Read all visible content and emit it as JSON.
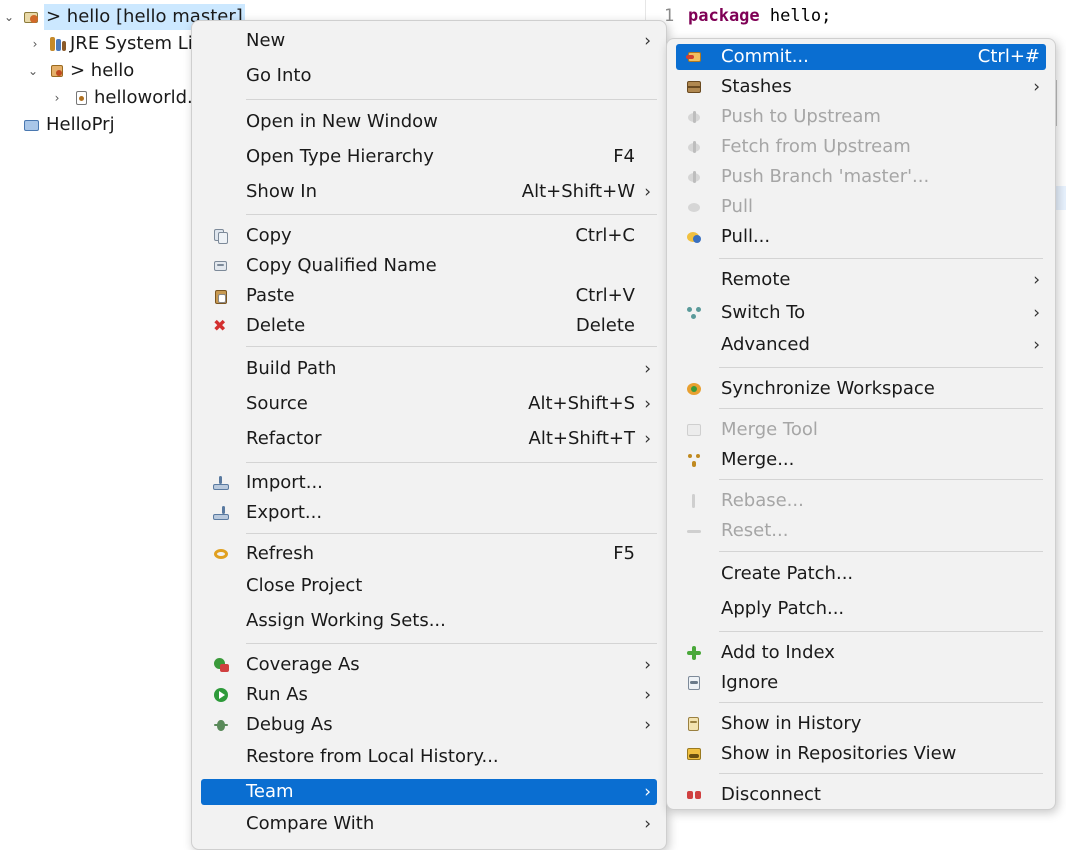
{
  "tree": {
    "project": "> hello [hello master]",
    "jre": "JRE System Lib",
    "package": "> hello",
    "file": "helloworld.",
    "other_project": "HelloPrj"
  },
  "editor": {
    "line1_number": "1",
    "line1_keyword": "package",
    "line1_rest": " hello;"
  },
  "context_menu": {
    "new": "New",
    "go_into": "Go Into",
    "open_new_window": "Open in New Window",
    "open_type_hierarchy": "Open Type Hierarchy",
    "open_type_hierarchy_sc": "F4",
    "show_in": "Show In",
    "show_in_sc": "Alt+Shift+W",
    "copy": "Copy",
    "copy_sc": "Ctrl+C",
    "copy_qualified": "Copy Qualified Name",
    "paste": "Paste",
    "paste_sc": "Ctrl+V",
    "delete": "Delete",
    "delete_sc": "Delete",
    "build_path": "Build Path",
    "source": "Source",
    "source_sc": "Alt+Shift+S",
    "refactor": "Refactor",
    "refactor_sc": "Alt+Shift+T",
    "import": "Import...",
    "export": "Export...",
    "refresh": "Refresh",
    "refresh_sc": "F5",
    "close_project": "Close Project",
    "assign_working_sets": "Assign Working Sets...",
    "coverage_as": "Coverage As",
    "run_as": "Run As",
    "debug_as": "Debug As",
    "restore_history": "Restore from Local History...",
    "team": "Team",
    "compare_with": "Compare With"
  },
  "team_menu": {
    "commit": "Commit...",
    "commit_sc": "Ctrl+#",
    "stashes": "Stashes",
    "push_upstream": "Push to Upstream",
    "fetch_upstream": "Fetch from Upstream",
    "push_branch": "Push Branch 'master'...",
    "pull": "Pull",
    "pull_dots": "Pull...",
    "remote": "Remote",
    "switch_to": "Switch To",
    "advanced": "Advanced",
    "synchronize": "Synchronize Workspace",
    "merge_tool": "Merge Tool",
    "merge": "Merge...",
    "rebase": "Rebase...",
    "reset": "Reset...",
    "create_patch": "Create Patch...",
    "apply_patch": "Apply Patch...",
    "add_to_index": "Add to Index",
    "ignore": "Ignore",
    "show_history": "Show in History",
    "show_repositories": "Show in Repositories View",
    "disconnect": "Disconnect"
  },
  "glyphs": {
    "submenu_arrow": "›",
    "expanded": "⌄",
    "collapsed": "›",
    "delete_x": "✖"
  },
  "colors": {
    "highlight": "#0a6ed1",
    "selection": "#cce8ff",
    "keyword": "#7f0055",
    "disabled": "#a6a6a6"
  }
}
